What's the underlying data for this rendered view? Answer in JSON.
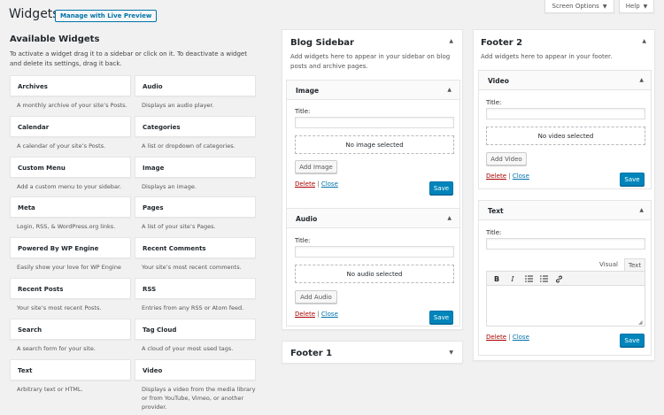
{
  "header": {
    "title": "Widgets",
    "preview_button": "Manage with Live Preview",
    "screen_options": "Screen Options",
    "help": "Help"
  },
  "available": {
    "heading": "Available Widgets",
    "description": "To activate a widget drag it to a sidebar or click on it. To deactivate a widget and delete its settings, drag it back.",
    "widgets": [
      {
        "name": "Archives",
        "desc": "A monthly archive of your site’s Posts."
      },
      {
        "name": "Audio",
        "desc": "Displays an audio player."
      },
      {
        "name": "Calendar",
        "desc": "A calendar of your site’s Posts."
      },
      {
        "name": "Categories",
        "desc": "A list or dropdown of categories."
      },
      {
        "name": "Custom Menu",
        "desc": "Add a custom menu to your sidebar."
      },
      {
        "name": "Image",
        "desc": "Displays an image."
      },
      {
        "name": "Meta",
        "desc": "Login, RSS, & WordPress.org links."
      },
      {
        "name": "Pages",
        "desc": "A list of your site’s Pages."
      },
      {
        "name": "Powered By WP Engine",
        "desc": "Easily show your love for WP Engine"
      },
      {
        "name": "Recent Comments",
        "desc": "Your site’s most recent comments."
      },
      {
        "name": "Recent Posts",
        "desc": "Your site’s most recent Posts."
      },
      {
        "name": "RSS",
        "desc": "Entries from any RSS or Atom feed."
      },
      {
        "name": "Search",
        "desc": "A search form for your site."
      },
      {
        "name": "Tag Cloud",
        "desc": "A cloud of your most used tags."
      },
      {
        "name": "Text",
        "desc": "Arbitrary text or HTML."
      },
      {
        "name": "Video",
        "desc": "Displays a video from the media library or from YouTube, Vimeo, or another provider."
      }
    ]
  },
  "blog_sidebar": {
    "title": "Blog Sidebar",
    "description": "Add widgets here to appear in your sidebar on blog posts and archive pages.",
    "image_widget": {
      "title": "Image",
      "field_label": "Title:",
      "title_value": "",
      "placeholder": "No image selected",
      "add_button": "Add Image",
      "delete": "Delete",
      "close": "Close",
      "save": "Save"
    },
    "audio_widget": {
      "title": "Audio",
      "field_label": "Title:",
      "title_value": "",
      "placeholder": "No audio selected",
      "add_button": "Add Audio",
      "delete": "Delete",
      "close": "Close",
      "save": "Save"
    }
  },
  "footer1": {
    "title": "Footer 1"
  },
  "footer2": {
    "title": "Footer 2",
    "description": "Add widgets here to appear in your footer.",
    "video_widget": {
      "title": "Video",
      "field_label": "Title:",
      "title_value": "",
      "placeholder": "No video selected",
      "add_button": "Add Video",
      "delete": "Delete",
      "close": "Close",
      "save": "Save"
    },
    "text_widget": {
      "title": "Text",
      "field_label": "Title:",
      "title_value": "",
      "tab_visual": "Visual",
      "tab_text": "Text",
      "toolbar": [
        "bold-icon",
        "italic-icon",
        "bullet-list-icon",
        "numbered-list-icon",
        "link-icon"
      ],
      "content": "",
      "delete": "Delete",
      "close": "Close",
      "save": "Save"
    }
  },
  "colors": {
    "primary": "#0085ba",
    "link": "#0073aa",
    "delete": "#a00000",
    "background": "#f1f1f1"
  }
}
